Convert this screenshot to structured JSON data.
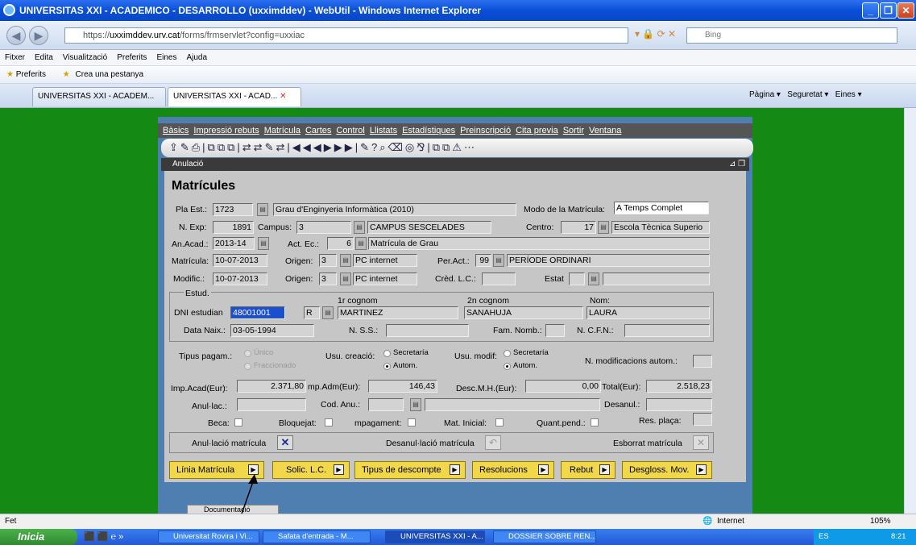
{
  "window": {
    "title": "UNIVERSITAS XXI - ACADEMICO - DESARROLLO (uxximddev) - WebUtil - Windows Internet Explorer"
  },
  "address": {
    "prefix": "https://",
    "host": "uxximddev.urv.cat",
    "path": "/forms/frmservlet?config=uxxiac",
    "search_placeholder": "Bing"
  },
  "ie_menu": [
    "Fitxer",
    "Edita",
    "Visualització",
    "Preferits",
    "Eines",
    "Ajuda"
  ],
  "favorites": {
    "label": "Preferits",
    "link": "Crea una pestanya"
  },
  "tabs": [
    "UNIVERSITAS XXI - ACADEM...",
    "UNIVERSITAS XXI - ACAD..."
  ],
  "tab_tools": [
    "Pàgina",
    "Seguretat",
    "Eines"
  ],
  "app_menu": [
    "Bàsics",
    "Impressió rebuts",
    "Matrícula",
    "Cartes",
    "Control",
    "Llistats",
    "Estadístiques",
    "Preinscripció",
    "Cita previa",
    "Sortir",
    "Ventana"
  ],
  "form_window_title": "Anulació",
  "form": {
    "heading": "Matrícules",
    "pla_est_label": "Pla Est.:",
    "pla_est": "1723",
    "pla_desc": "Grau d'Enginyeria Informàtica (2010)",
    "modo_label": "Modo de la Matrícula:",
    "modo": "A Temps Complet",
    "nexp_label": "N. Exp:",
    "nexp": "1891",
    "campus_label": "Campus:",
    "campus": "3",
    "campus_desc": "CAMPUS SESCELADES",
    "centro_label": "Centro:",
    "centro": "17",
    "centro_desc": "Escola Tècnica Superio",
    "anacad_label": "An.Acad.:",
    "anacad": "2013-14",
    "actec_label": "Act. Ec.:",
    "actec": "6",
    "actec_desc": "Matrícula de Grau",
    "matricula_label": "Matrícula:",
    "matricula": "10-07-2013",
    "origen_label": "Origen:",
    "origen1": "3",
    "origen1_desc": "PC internet",
    "peract_label": "Per.Act.:",
    "peract": "99",
    "peract_desc": "PERÍODE ORDINARI",
    "modific_label": "Modific.:",
    "modific": "10-07-2013",
    "origen2": "3",
    "origen2_desc": "PC internet",
    "cred_label": "Crèd. L.C.:",
    "estat_label": "Estat",
    "estud_label": "Estud.",
    "cog1_label": "1r cognom",
    "cog2_label": "2n cognom",
    "nom_label": "Nom:",
    "dni_label": "DNI estudian",
    "dni": "48001001",
    "dni_letter": "R",
    "cog1": "MARTINEZ",
    "cog2": "SANAHUJA",
    "nom": "LAURA",
    "datanaix_label": "Data Naix.:",
    "datanaix": "03-05-1994",
    "nss_label": "N. S.S.:",
    "famnomb_label": "Fam. Nomb.:",
    "ncfn_label": "N. C.F.N.:",
    "tipuspag_label": "Tipus pagam.:",
    "unico": "Único",
    "fracc": "Fraccionado",
    "usucre_label": "Usu. creació:",
    "secretaria": "Secretaría",
    "autom": "Autom.",
    "usumod_label": "Usu. modif:",
    "nmodif_label": "N. modificacions autom.:",
    "impacad_label": "Imp.Acad(Eur):",
    "impacad": "2.371,80",
    "impadm_label": "mp.Adm(Eur):",
    "impadm": "146,43",
    "descmh_label": "Desc.M.H.(Eur):",
    "descmh": "0,00",
    "total_label": "Total(Eur):",
    "total": "2.518,23",
    "anullac_label": "Anul·lac.:",
    "codanu_label": "Cod. Anu.:",
    "desanul_label": "Desanul.:",
    "beca_label": "Beca:",
    "bloq_label": "Bloquejat:",
    "impag_label": "mpagament:",
    "matini_label": "Mat. Inicial:",
    "quant_label": "Quant.pend.:",
    "resplaca_label": "Res. plaça:",
    "anul_mat": "Anul·lació matrícula",
    "desanul_mat": "Desanul·lació matrícula",
    "esborrat": "Esborrat matrícula",
    "buttons": [
      "Línia Matrícula",
      "Solic. L.C.",
      "Tipus de descompte",
      "Resolucions",
      "Rebut",
      "Desgloss. Mov."
    ],
    "bottom_tab": "Documentació"
  },
  "status": {
    "left": "Fet",
    "zone": "Internet",
    "zoom": "105%"
  },
  "taskbar": {
    "start": "Inicia",
    "items": [
      "Universitat Rovira i Vi...",
      "Safata d'entrada - M...",
      "UNIVERSITAS XXI - A...",
      "DOSSIER SOBRE REN..."
    ],
    "lang": "ES",
    "time": "8:21"
  }
}
